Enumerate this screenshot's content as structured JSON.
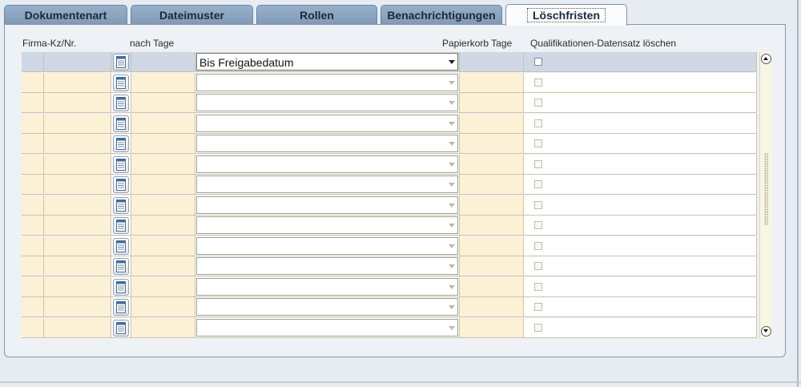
{
  "tabs": [
    {
      "label": "Dokumentenart",
      "active": false
    },
    {
      "label": "Dateimuster",
      "active": false
    },
    {
      "label": "Rollen",
      "active": false
    },
    {
      "label": "Benachrichtigungen",
      "active": false
    },
    {
      "label": "Löschfristen",
      "active": true
    }
  ],
  "columns": {
    "firma": "Firma-Kz/Nr.",
    "nach_tage": "nach Tage",
    "papierkorb": "Papierkorb Tage",
    "quali": "Qualifikationen-Datensatz löschen"
  },
  "rows": [
    {
      "select_value": "Bis Freigabedatum",
      "checked": false,
      "selected": true
    },
    {
      "select_value": "",
      "checked": false,
      "selected": false
    },
    {
      "select_value": "",
      "checked": false,
      "selected": false
    },
    {
      "select_value": "",
      "checked": false,
      "selected": false
    },
    {
      "select_value": "",
      "checked": false,
      "selected": false
    },
    {
      "select_value": "",
      "checked": false,
      "selected": false
    },
    {
      "select_value": "",
      "checked": false,
      "selected": false
    },
    {
      "select_value": "",
      "checked": false,
      "selected": false
    },
    {
      "select_value": "",
      "checked": false,
      "selected": false
    },
    {
      "select_value": "",
      "checked": false,
      "selected": false
    },
    {
      "select_value": "",
      "checked": false,
      "selected": false
    },
    {
      "select_value": "",
      "checked": false,
      "selected": false
    },
    {
      "select_value": "",
      "checked": false,
      "selected": false
    },
    {
      "select_value": "",
      "checked": false,
      "selected": false
    }
  ],
  "colors": {
    "tab": "#8aa3bf",
    "active_tab": "#fbfcfd",
    "yellow_cell": "#fdf1d5",
    "selected_row": "#cfd8e4"
  }
}
